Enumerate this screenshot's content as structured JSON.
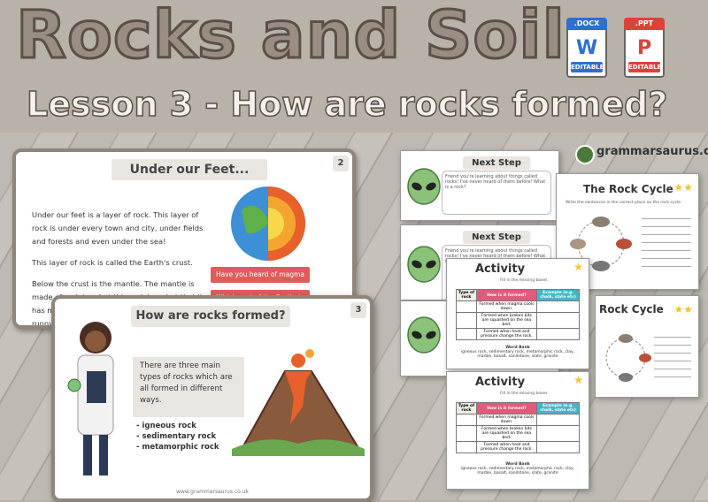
{
  "header": {
    "title": "Rocks and Soils",
    "subtitle": "Lesson 3 - How are rocks formed?"
  },
  "file_badges": [
    {
      "ext": ".DOCX",
      "glyph": "W",
      "label": "EDITABLE",
      "color": "#2f6fce"
    },
    {
      "ext": ".PPT",
      "glyph": "P",
      "label": "EDITABLE",
      "color": "#d9443a"
    }
  ],
  "slide1": {
    "heading": "Under our Feet...",
    "number": "2",
    "paragraphs": [
      "Under our feet is a layer of rock. This layer of rock is under every town and city, under fields and forests and even under the sea!",
      "This layer of rock is called the Earth's crust.",
      "Below the crust is the mantle. The mantle is made of rock too, but this rock is so hot that it has melted! It is called magma. It is thick and runny, like syrup."
    ],
    "questions": [
      "Have you heard of magma before?",
      "Which part of the Earth do you"
    ]
  },
  "slide2": {
    "heading": "How are rocks formed?",
    "number": "3",
    "intro": "There are three main types of rocks which are all formed in different ways.",
    "types": [
      "- igneous rock",
      "- sedimentary rock",
      "- metamorphic rock"
    ],
    "footer": "www.grammarsaurus.co.uk"
  },
  "worksheets": {
    "next_step_heading": "Next Step",
    "next_step_prompt": "Friend you're learning about things called rocks! I've never heard of them before! What is a rock?",
    "activity_heading": "Activity",
    "activity_instruction": "Fill in the missing boxes",
    "activity_columns": [
      "Type of rock",
      "How is it formed?",
      "Example (e.g. chalk, slate etc)"
    ],
    "activity_rows": [
      "Formed when magma cools down.",
      "Formed when broken bits are squashed on the sea bed.",
      "Formed when heat and pressure change the rock."
    ],
    "word_bank_title": "Word Bank",
    "word_bank": "igneous rock, sedimentary rock, metamorphic rock, clay, marble, basalt, sandstone, slate, granite",
    "rock_cycle_heading": "The Rock Cycle",
    "rock_cycle_heading_2": "Rock Cycle",
    "rock_cycle_instruction": "Write the sentences in the correct place on the rock cycle."
  },
  "brand": {
    "name": "grammarsaurus.co.uk"
  }
}
